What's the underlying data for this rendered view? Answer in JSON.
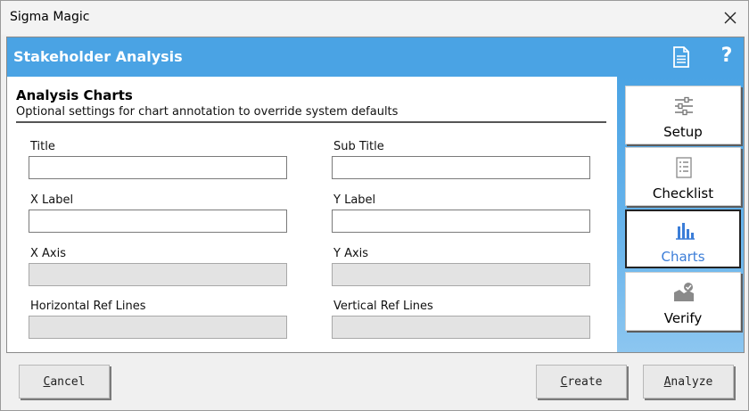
{
  "window": {
    "title": "Sigma Magic"
  },
  "header": {
    "title": "Stakeholder Analysis"
  },
  "section": {
    "title": "Analysis Charts",
    "subtitle": "Optional settings for chart annotation to override system defaults"
  },
  "fields": {
    "title": {
      "label": "Title",
      "value": ""
    },
    "sub_title": {
      "label": "Sub Title",
      "value": ""
    },
    "x_label": {
      "label": "X Label",
      "value": ""
    },
    "y_label": {
      "label": "Y Label",
      "value": ""
    },
    "x_axis": {
      "label": "X Axis",
      "value": ""
    },
    "y_axis": {
      "label": "Y Axis",
      "value": ""
    },
    "h_ref": {
      "label": "Horizontal Ref Lines",
      "value": ""
    },
    "v_ref": {
      "label": "Vertical Ref Lines",
      "value": ""
    }
  },
  "nav": {
    "setup": "Setup",
    "checklist": "Checklist",
    "charts": "Charts",
    "verify": "Verify"
  },
  "buttons": {
    "cancel": {
      "first": "C",
      "rest": "ancel"
    },
    "create": {
      "first": "C",
      "rest": "reate"
    },
    "analyze": {
      "first": "A",
      "rest": "nalyze"
    }
  },
  "colors": {
    "header_blue": "#4aa3e4",
    "active_nav_text": "#3b7dd8"
  }
}
